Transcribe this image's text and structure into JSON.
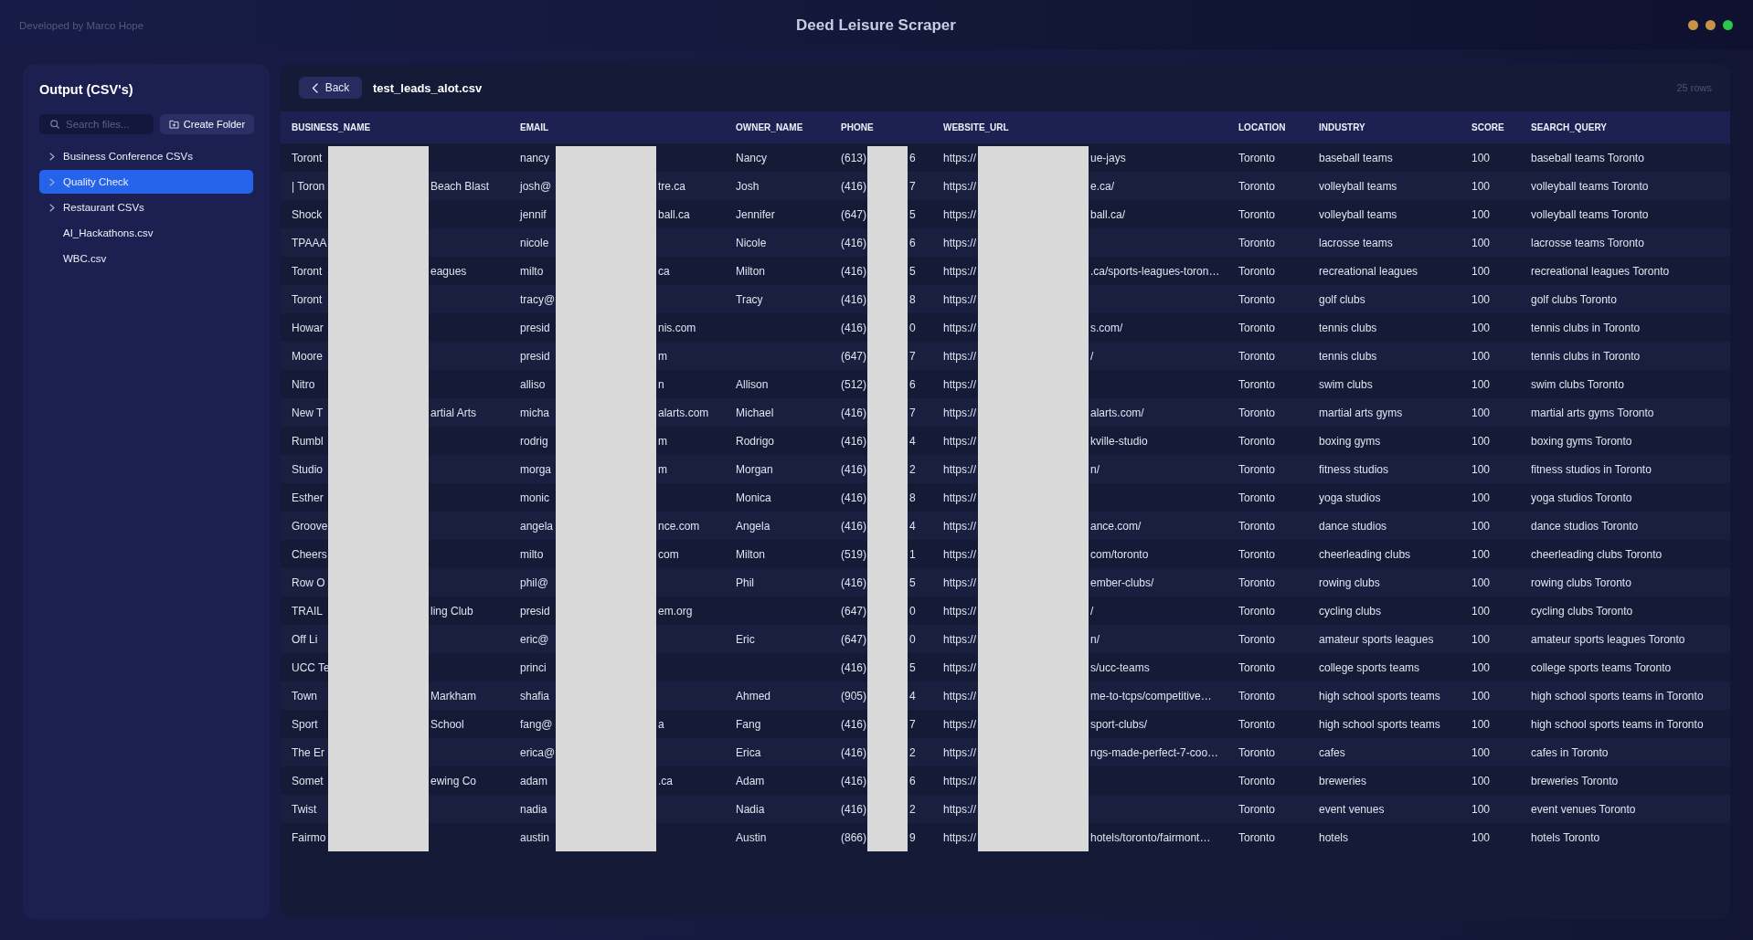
{
  "window": {
    "credit": "Developed by Marco Hope",
    "title": "Deed Leisure Scraper",
    "controls": [
      {
        "color": "#c99249"
      },
      {
        "color": "#c99249"
      },
      {
        "color": "#2bc64a"
      }
    ]
  },
  "sidebar": {
    "title": "Output (CSV's)",
    "search": {
      "placeholder": "Search files..."
    },
    "create_button": "Create Folder",
    "items": [
      {
        "kind": "folder",
        "label": "Business Conference CSVs",
        "expanded": false,
        "selected": false
      },
      {
        "kind": "folder",
        "label": "Quality Check",
        "expanded": false,
        "selected": true
      },
      {
        "kind": "folder",
        "label": "Restaurant CSVs",
        "expanded": false,
        "selected": false
      },
      {
        "kind": "file",
        "label": "AI_Hackathons.csv",
        "selected": false
      },
      {
        "kind": "file",
        "label": "WBC.csv",
        "selected": false
      }
    ]
  },
  "viewer": {
    "back_button": "Back",
    "file_name": "test_leads_alot.csv",
    "row_count": "25 rows",
    "table": {
      "columns": [
        {
          "label": "BUSINESS_NAME",
          "redacted": true
        },
        {
          "label": "EMAIL",
          "redacted": true
        },
        {
          "label": "OWNER_NAME",
          "redacted": false
        },
        {
          "label": "PHONE",
          "redacted": true
        },
        {
          "label": "WEBSITE_URL",
          "redacted": true
        },
        {
          "label": "LOCATION",
          "redacted": false
        },
        {
          "label": "INDUSTRY",
          "redacted": false
        },
        {
          "label": "SCORE",
          "redacted": false
        },
        {
          "label": "SEARCH_QUERY",
          "redacted": false
        }
      ],
      "rows": [
        [
          {
            "start": "Toront"
          },
          {
            "start": "nancy"
          },
          "Nancy",
          {
            "start": "(613)",
            "end": "6"
          },
          {
            "start": "https://",
            "end": "ue-jays"
          },
          "Toronto",
          "baseball teams",
          "100",
          "baseball teams Toronto"
        ],
        [
          {
            "start": "| Toron",
            "end": "Beach Blast"
          },
          {
            "start": "josh@",
            "end": "tre.ca"
          },
          "Josh",
          {
            "start": "(416)",
            "end": "7"
          },
          {
            "start": "https://",
            "end": "e.ca/"
          },
          "Toronto",
          "volleyball teams",
          "100",
          "volleyball teams Toronto"
        ],
        [
          {
            "start": "Shock"
          },
          {
            "start": "jennif",
            "end": "ball.ca"
          },
          "Jennifer",
          {
            "start": "(647)",
            "end": "5"
          },
          {
            "start": "https://",
            "end": "ball.ca/"
          },
          "Toronto",
          "volleyball teams",
          "100",
          "volleyball teams Toronto"
        ],
        [
          {
            "start": "TPAAA"
          },
          {
            "start": "nicole"
          },
          "Nicole",
          {
            "start": "(416)",
            "end": "6"
          },
          {
            "start": "https://"
          },
          "Toronto",
          "lacrosse teams",
          "100",
          "lacrosse teams Toronto"
        ],
        [
          {
            "start": "Toront",
            "end": "eagues"
          },
          {
            "start": "milto",
            "end": "ca"
          },
          "Milton",
          {
            "start": "(416)",
            "end": "5"
          },
          {
            "start": "https://",
            "end": ".ca/sports-leagues-toron…"
          },
          "Toronto",
          "recreational leagues",
          "100",
          "recreational leagues Toronto"
        ],
        [
          {
            "start": "Toront"
          },
          {
            "start": "tracy@"
          },
          "Tracy",
          {
            "start": "(416)",
            "end": "8"
          },
          {
            "start": "https://"
          },
          "Toronto",
          "golf clubs",
          "100",
          "golf clubs Toronto"
        ],
        [
          {
            "start": "Howar"
          },
          {
            "start": "presid",
            "end": "nis.com"
          },
          null,
          {
            "start": "(416)",
            "end": "0"
          },
          {
            "start": "https://",
            "end": "s.com/"
          },
          "Toronto",
          "tennis clubs",
          "100",
          "tennis clubs in Toronto"
        ],
        [
          {
            "start": "Moore"
          },
          {
            "start": "presid",
            "end": "m"
          },
          null,
          {
            "start": "(647)",
            "end": "7"
          },
          {
            "start": "https://",
            "end": "/"
          },
          "Toronto",
          "tennis clubs",
          "100",
          "tennis clubs in Toronto"
        ],
        [
          {
            "start": "Nitro"
          },
          {
            "start": "alliso",
            "end": "n"
          },
          "Allison",
          {
            "start": "(512)",
            "end": "6"
          },
          {
            "start": "https://"
          },
          "Toronto",
          "swim clubs",
          "100",
          "swim clubs Toronto"
        ],
        [
          {
            "start": "New T",
            "end": "artial Arts"
          },
          {
            "start": "micha",
            "end": "alarts.com"
          },
          "Michael",
          {
            "start": "(416)",
            "end": "7"
          },
          {
            "start": "https://",
            "end": "alarts.com/"
          },
          "Toronto",
          "martial arts gyms",
          "100",
          "martial arts gyms Toronto"
        ],
        [
          {
            "start": "Rumbl"
          },
          {
            "start": "rodrig",
            "end": "m"
          },
          "Rodrigo",
          {
            "start": "(416)",
            "end": "4"
          },
          {
            "start": "https://",
            "end": "kville-studio"
          },
          "Toronto",
          "boxing gyms",
          "100",
          "boxing gyms Toronto"
        ],
        [
          {
            "start": "Studio"
          },
          {
            "start": "morga",
            "end": "m"
          },
          "Morgan",
          {
            "start": "(416)",
            "end": "2"
          },
          {
            "start": "https://",
            "end": "n/"
          },
          "Toronto",
          "fitness studios",
          "100",
          "fitness studios in Toronto"
        ],
        [
          {
            "start": "Esther"
          },
          {
            "start": "monic"
          },
          "Monica",
          {
            "start": "(416)",
            "end": "8"
          },
          {
            "start": "https://"
          },
          "Toronto",
          "yoga studios",
          "100",
          "yoga studios Toronto"
        ],
        [
          {
            "start": "Groove"
          },
          {
            "start": "angela",
            "end": "nce.com"
          },
          "Angela",
          {
            "start": "(416)",
            "end": "4"
          },
          {
            "start": "https://",
            "end": "ance.com/"
          },
          "Toronto",
          "dance studios",
          "100",
          "dance studios Toronto"
        ],
        [
          {
            "start": "Cheers"
          },
          {
            "start": "milto",
            "end": "com"
          },
          "Milton",
          {
            "start": "(519)",
            "end": "1"
          },
          {
            "start": "https://",
            "end": "com/toronto"
          },
          "Toronto",
          "cheerleading clubs",
          "100",
          "cheerleading clubs Toronto"
        ],
        [
          {
            "start": "Row O"
          },
          {
            "start": "phil@"
          },
          "Phil",
          {
            "start": "(416)",
            "end": "5"
          },
          {
            "start": "https://",
            "end": "ember-clubs/"
          },
          "Toronto",
          "rowing clubs",
          "100",
          "rowing clubs Toronto"
        ],
        [
          {
            "start": "TRAIL",
            "end": "ling Club"
          },
          {
            "start": "presid",
            "end": "em.org"
          },
          null,
          {
            "start": "(647)",
            "end": "0"
          },
          {
            "start": "https://",
            "end": "/"
          },
          "Toronto",
          "cycling clubs",
          "100",
          "cycling clubs Toronto"
        ],
        [
          {
            "start": "Off Li"
          },
          {
            "start": "eric@"
          },
          "Eric",
          {
            "start": "(647)",
            "end": "0"
          },
          {
            "start": "https://",
            "end": "n/"
          },
          "Toronto",
          "amateur sports leagues",
          "100",
          "amateur sports leagues Toronto"
        ],
        [
          {
            "start": "UCC Te"
          },
          {
            "start": "princi"
          },
          null,
          {
            "start": "(416)",
            "end": "5"
          },
          {
            "start": "https://",
            "end": "s/ucc-teams"
          },
          "Toronto",
          "college sports teams",
          "100",
          "college sports teams Toronto"
        ],
        [
          {
            "start": "Town",
            "end": "Markham"
          },
          {
            "start": "shafia"
          },
          "Ahmed",
          {
            "start": "(905)",
            "end": "4"
          },
          {
            "start": "https://",
            "end": "me-to-tcps/competitive…"
          },
          "Toronto",
          "high school sports teams",
          "100",
          "high school sports teams in Toronto"
        ],
        [
          {
            "start": "Sport",
            "end": "School"
          },
          {
            "start": "fang@",
            "end": "a"
          },
          "Fang",
          {
            "start": "(416)",
            "end": "7"
          },
          {
            "start": "https://",
            "end": "sport-clubs/"
          },
          "Toronto",
          "high school sports teams",
          "100",
          "high school sports teams in Toronto"
        ],
        [
          {
            "start": "The Er"
          },
          {
            "start": "erica@"
          },
          "Erica",
          {
            "start": "(416)",
            "end": "2"
          },
          {
            "start": "https://",
            "end": "ngs-made-perfect-7-coo…"
          },
          "Toronto",
          "cafes",
          "100",
          "cafes in Toronto"
        ],
        [
          {
            "start": "Somet",
            "end": "ewing Co"
          },
          {
            "start": "adam",
            "end": ".ca"
          },
          "Adam",
          {
            "start": "(416)",
            "end": "6"
          },
          {
            "start": "https://"
          },
          "Toronto",
          "breweries",
          "100",
          "breweries Toronto"
        ],
        [
          {
            "start": "Twist"
          },
          {
            "start": "nadia"
          },
          "Nadia",
          {
            "start": "(416)",
            "end": "2"
          },
          {
            "start": "https://"
          },
          "Toronto",
          "event venues",
          "100",
          "event venues Toronto"
        ],
        [
          {
            "start": "Fairmo"
          },
          {
            "start": "austin"
          },
          "Austin",
          {
            "start": "(866)",
            "end": "9"
          },
          {
            "start": "https://",
            "end": "hotels/toronto/fairmont…"
          },
          "Toronto",
          "hotels",
          "100",
          "hotels Toronto"
        ]
      ]
    }
  }
}
